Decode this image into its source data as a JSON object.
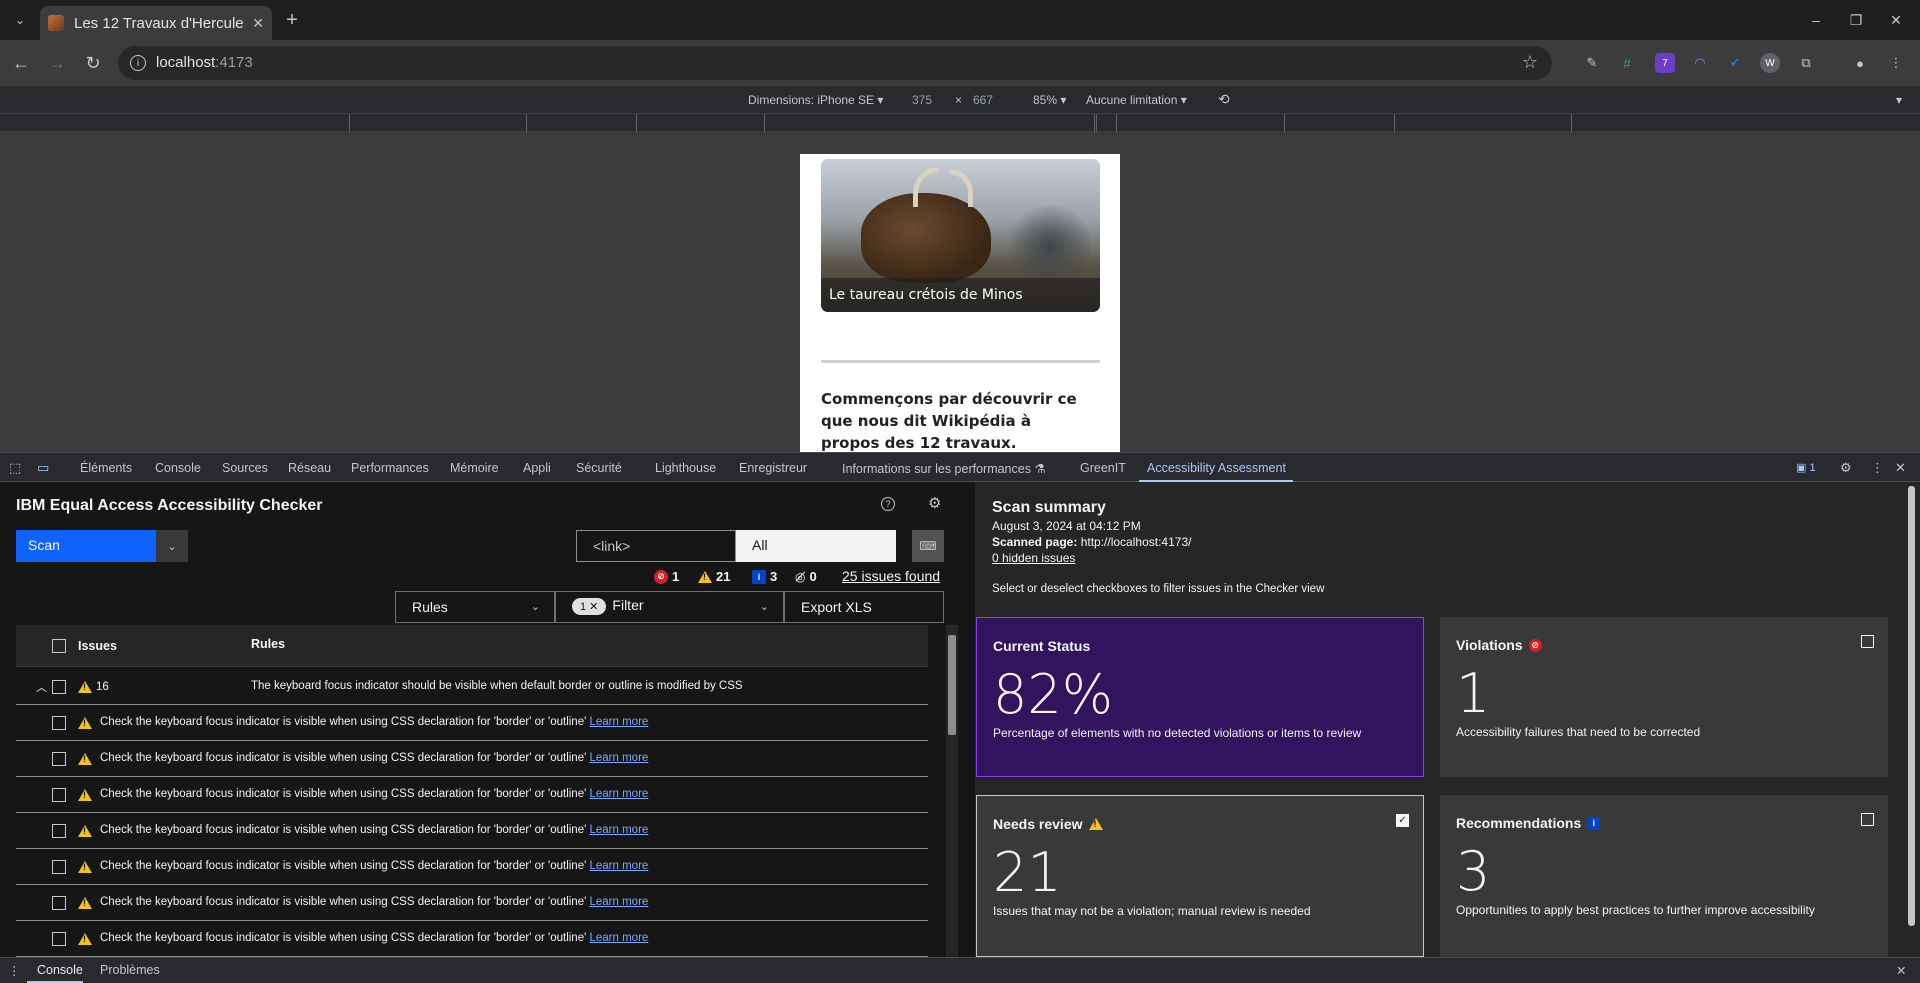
{
  "browser": {
    "tab_title": "Les 12 Travaux d'Hercule",
    "url_host": "localhost",
    "url_port": ":4173",
    "extension_badge": "7"
  },
  "device_toolbar": {
    "dimensions_label": "Dimensions: iPhone SE",
    "width": "375",
    "times": "×",
    "height": "667",
    "zoom": "85%",
    "throttle": "Aucune limitation"
  },
  "page": {
    "caption": "Le taureau crétois de Minos",
    "intro": "Commençons par découvrir ce que nous dit Wikipédia à propos des 12 travaux."
  },
  "devtools_tabs": [
    "Éléments",
    "Console",
    "Sources",
    "Réseau",
    "Performances",
    "Mémoire",
    "Appli",
    "Sécurité",
    "Lighthouse",
    "Enregistreur",
    "Informations sur les performances",
    "GreenIT",
    "Accessibility Assessment"
  ],
  "devtools_issue_count": "1",
  "checker": {
    "title": "IBM Equal Access Accessibility Checker",
    "scan_label": "Scan",
    "link_field": "<link>",
    "all_field": "All",
    "count_violations": "1",
    "count_review": "21",
    "count_recommendations": "3",
    "count_hidden": "0",
    "issues_found": "25 issues found",
    "rules_label": "Rules",
    "filter_count": "1",
    "filter_label": "Filter",
    "export_label": "Export XLS",
    "col_issues": "Issues",
    "col_rules": "Rules",
    "group_count": "16",
    "group_rule": "The keyboard focus indicator should be visible when default border or outline is modified by CSS",
    "issue_text": "Check the keyboard focus indicator is visible when using CSS declaration for 'border' or 'outline'",
    "learn_more": "Learn more"
  },
  "summary": {
    "title": "Scan summary",
    "date": "August 3, 2024 at 04:12 PM",
    "scanned_label": "Scanned page:",
    "scanned_url": "http://localhost:4173/",
    "hidden_issues": "0 hidden issues",
    "instruction": "Select or deselect checkboxes to filter issues in the Checker view",
    "current_status": {
      "title": "Current Status",
      "value": "82%",
      "desc": "Percentage of elements with no detected violations or items to review"
    },
    "violations": {
      "title": "Violations",
      "value": "1",
      "desc": "Accessibility failures that need to be corrected"
    },
    "needs_review": {
      "title": "Needs review",
      "value": "21",
      "desc": "Issues that may not be a violation; manual review is needed"
    },
    "recommendations": {
      "title": "Recommendations",
      "value": "3",
      "desc": "Opportunities to apply best practices to further improve accessibility"
    }
  },
  "drawer": {
    "console": "Console",
    "problems": "Problèmes"
  },
  "colors": {
    "accent": "#0f62fe",
    "current_status_bg": "#31135e",
    "warning": "#f1c21b",
    "violation": "#da1e28",
    "info": "#0043ce"
  }
}
